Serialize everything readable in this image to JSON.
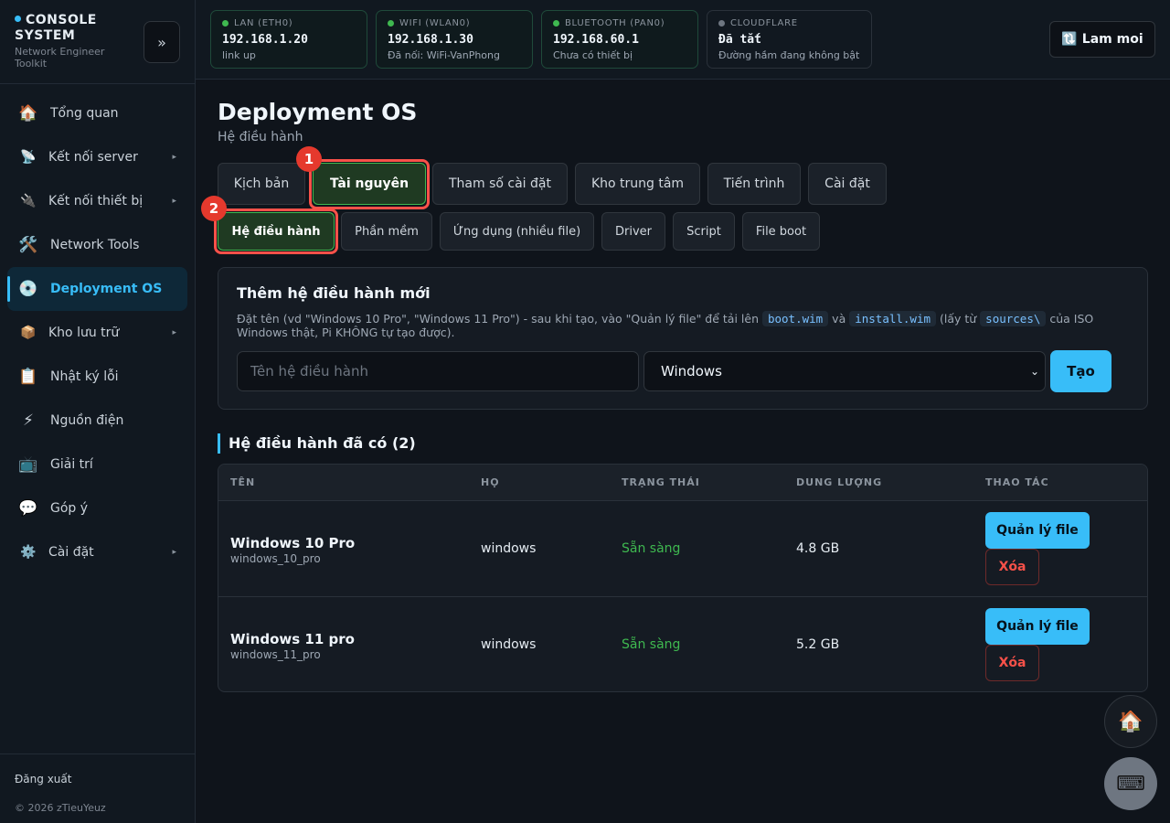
{
  "brand": {
    "title": "CONSOLE SYSTEM",
    "subtitle": "Network Engineer Toolkit",
    "collapse": "»"
  },
  "nav": [
    {
      "label": "Tổng quan",
      "icon": "🏠"
    },
    {
      "label": "Kết nối server",
      "icon": "📡"
    },
    {
      "label": "Kết nối thiết bị",
      "icon": "🔌"
    },
    {
      "label": "Network Tools",
      "icon": "🛠️"
    },
    {
      "label": "Deployment OS",
      "icon": "💿"
    },
    {
      "label": "Kho lưu trữ",
      "icon": "📦"
    },
    {
      "label": "Nhật ký lỗi",
      "icon": "📋"
    },
    {
      "label": "Nguồn điện",
      "icon": "⚡"
    },
    {
      "label": "Giải trí",
      "icon": "📺"
    },
    {
      "label": "Góp ý",
      "icon": "💬"
    },
    {
      "label": "Cài đặt",
      "icon": "⚙️"
    }
  ],
  "sidebar_footer": {
    "logout": "Đăng xuất",
    "copyright": "© 2026 zTieuYeuz"
  },
  "network": [
    {
      "label": "LAN (ETH0)",
      "ip": "192.168.1.20",
      "status": "link up"
    },
    {
      "label": "WIFI (WLAN0)",
      "ip": "192.168.1.30",
      "status": "Đã nối: WiFi-VanPhong"
    },
    {
      "label": "BLUETOOTH (PAN0)",
      "ip": "192.168.60.1",
      "status": "Chưa có thiết bị"
    },
    {
      "label": "CLOUDFLARE",
      "ip": "Đã tắt",
      "status": "Đường hầm đang không bật"
    }
  ],
  "refresh": {
    "icon": "🔃",
    "label": "Lam moi"
  },
  "page": {
    "title": "Deployment OS",
    "subtitle": "Hệ điều hành"
  },
  "tabs": [
    "Kịch bản",
    "Tài nguyên",
    "Tham số cài đặt",
    "Kho trung tâm",
    "Tiến trình",
    "Cài đặt"
  ],
  "subtabs": [
    "Hệ điều hành",
    "Phần mềm",
    "Ứng dụng (nhiều file)",
    "Driver",
    "Script",
    "File boot"
  ],
  "badges": [
    "1",
    "2"
  ],
  "create": {
    "title": "Thêm hệ điều hành mới",
    "desc_1": "Đặt tên (vd \"Windows 10 Pro\", \"Windows 11 Pro\") - sau khi tạo, vào \"Quản lý file\" để tải lên ",
    "code_1": "boot.wim",
    "desc_2": " và ",
    "code_2": "install.wim",
    "desc_3": " (lấy từ ",
    "code_3": "sources\\",
    "desc_4": " của ISO Windows thật, Pi KHÔNG tự tạo được).",
    "placeholder": "Tên hệ điều hành",
    "select_value": "Windows",
    "button": "Tạo"
  },
  "section": {
    "title": "Hệ điều hành đã có (2)"
  },
  "table": {
    "headers": [
      "TÊN",
      "HỌ",
      "TRẠNG THÁI",
      "DUNG LƯỢNG",
      "THAO TÁC"
    ],
    "rows": [
      {
        "name": "Windows 10 Pro",
        "slug": "windows_10_pro",
        "family": "windows",
        "status": "Sẵn sàng",
        "size": "4.8 GB",
        "manage": "Quản lý file",
        "delete": "Xóa"
      },
      {
        "name": "Windows 11 pro",
        "slug": "windows_11_pro",
        "family": "windows",
        "status": "Sẵn sàng",
        "size": "5.2 GB",
        "manage": "Quản lý file",
        "delete": "Xóa"
      }
    ]
  },
  "fab": {
    "home_icon": "🏠",
    "keyboard_icon": "⌨"
  },
  "colors": {
    "accent": "#38bdf8",
    "success": "#3fb950",
    "danger": "#f85149",
    "background": "#0f141b"
  }
}
